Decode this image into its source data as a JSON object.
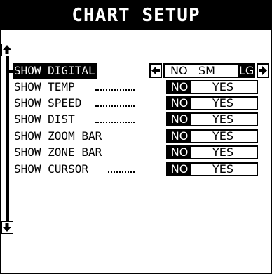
{
  "title": "CHART SETUP",
  "rows": [
    {
      "label": "SHOW DIGITAL",
      "type": "size",
      "options": [
        "NO",
        "SM",
        "LG"
      ],
      "selected": "LG"
    },
    {
      "label": "SHOW TEMP",
      "type": "toggle",
      "options": [
        "NO",
        "YES"
      ],
      "selected": "NO"
    },
    {
      "label": "SHOW SPEED",
      "type": "toggle",
      "options": [
        "NO",
        "YES"
      ],
      "selected": "NO"
    },
    {
      "label": "SHOW DIST",
      "type": "toggle",
      "options": [
        "NO",
        "YES"
      ],
      "selected": "NO"
    },
    {
      "label": "SHOW ZOOM BAR",
      "type": "toggle",
      "options": [
        "NO",
        "YES"
      ],
      "selected": "NO"
    },
    {
      "label": "SHOW ZONE BAR",
      "type": "toggle",
      "options": [
        "NO",
        "YES"
      ],
      "selected": "NO"
    },
    {
      "label": "SHOW CURSOR",
      "type": "toggle",
      "options": [
        "NO",
        "YES"
      ],
      "selected": "NO"
    }
  ],
  "icons": {
    "scroll_up": "arrow-up-icon",
    "scroll_down": "arrow-down-icon",
    "prev": "arrow-left-icon",
    "next": "arrow-right-icon"
  },
  "colors": {
    "foreground": "#000000",
    "background": "#ffffff"
  }
}
